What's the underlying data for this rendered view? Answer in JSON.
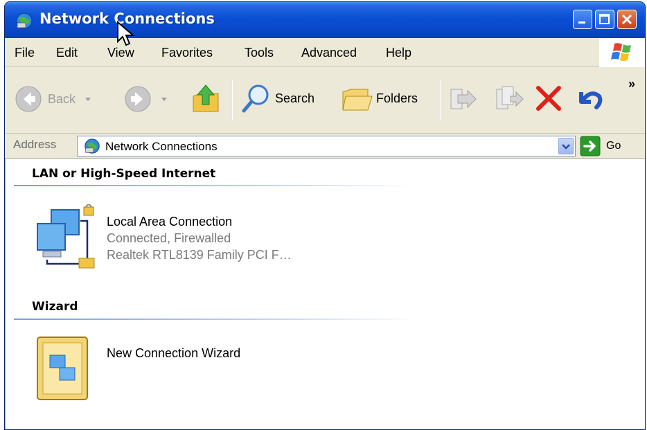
{
  "window": {
    "title": "Network Connections",
    "controls": [
      "minimize",
      "maximize",
      "close"
    ]
  },
  "menu": {
    "items": [
      "File",
      "Edit",
      "View",
      "Favorites",
      "Tools",
      "Advanced",
      "Help"
    ]
  },
  "toolbar": {
    "back_label": "Back",
    "search_label": "Search",
    "folders_label": "Folders",
    "more": "»"
  },
  "address": {
    "label": "Address",
    "value": "Network Connections",
    "go_label": "Go"
  },
  "groups": [
    {
      "header": "LAN or High-Speed Internet",
      "items": [
        {
          "name": "Local Area Connection",
          "status": "Connected, Firewalled",
          "device": "Realtek RTL8139 Family PCI F…"
        }
      ]
    },
    {
      "header": "Wizard",
      "items": [
        {
          "name": "New Connection Wizard"
        }
      ]
    }
  ],
  "colors": {
    "title_bar": "#0a4fd4",
    "chrome": "#ece9d8",
    "stop_red": "#e0201a",
    "go_green": "#2a9b2a"
  }
}
